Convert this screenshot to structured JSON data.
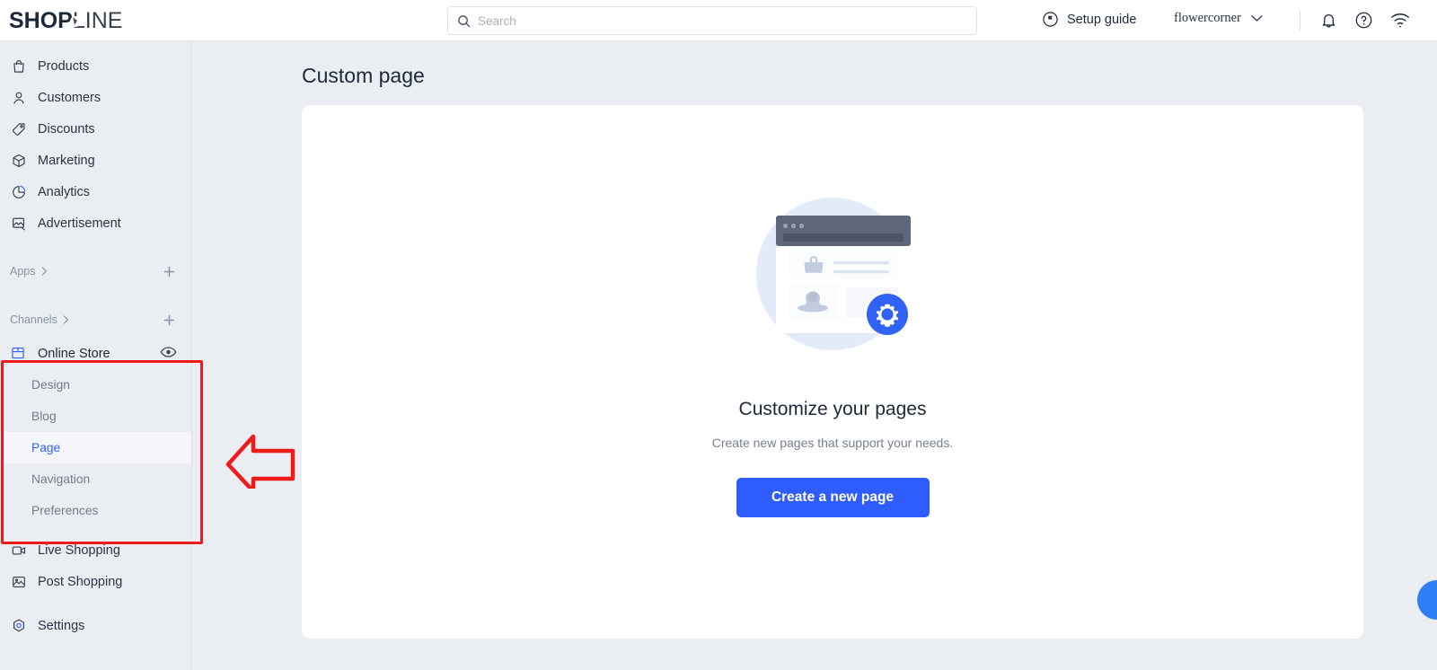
{
  "app": {
    "brand_bold": "SHOP",
    "brand_light": "LINE",
    "accent_blue": "#2f5cfd",
    "annotation_red": "#ee1b1b"
  },
  "topbar": {
    "search": {
      "placeholder": "Search",
      "value": ""
    },
    "setup_guide": "Setup guide",
    "store_name": "flowercorner",
    "icons": {
      "search": "search-icon",
      "setup": "flag-circle-icon",
      "chevron": "chevron-down-icon",
      "bell": "bell-icon",
      "help": "help-circle-icon",
      "wifi": "wifi-icon"
    }
  },
  "sidebar": {
    "primary": [
      {
        "label": "Products",
        "icon": "bag-icon"
      },
      {
        "label": "Customers",
        "icon": "person-icon"
      },
      {
        "label": "Discounts",
        "icon": "tag-icon"
      },
      {
        "label": "Marketing",
        "icon": "cube-icon"
      },
      {
        "label": "Analytics",
        "icon": "pie-chart-icon"
      },
      {
        "label": "Advertisement",
        "icon": "advertisement-icon"
      }
    ],
    "apps_section": {
      "label": "Apps",
      "add_label": "+"
    },
    "channels_section": {
      "label": "Channels",
      "add_label": "+"
    },
    "online_store": {
      "label": "Online Store",
      "icon": "store-icon",
      "preview_icon": "eye-icon"
    },
    "online_store_children": [
      {
        "label": "Design",
        "active": false
      },
      {
        "label": "Blog",
        "active": false
      },
      {
        "label": "Page",
        "active": true
      },
      {
        "label": "Navigation",
        "active": false
      },
      {
        "label": "Preferences",
        "active": false
      }
    ],
    "secondary": [
      {
        "label": "Live Shopping",
        "icon": "video-camera-icon"
      },
      {
        "label": "Post Shopping",
        "icon": "image-icon"
      }
    ],
    "settings": {
      "label": "Settings",
      "icon": "settings-gear-icon"
    }
  },
  "main": {
    "page_title": "Custom page",
    "empty_state": {
      "title": "Customize your pages",
      "subtitle": "Create new pages that support your needs.",
      "cta_label": "Create a new page",
      "illustration": "browser-window-with-gear-illustration"
    }
  },
  "annotations": {
    "highlight_box": "red-rectangle-around-online-store-menu",
    "arrow": "red-left-arrow-pointing-to-page-menu"
  }
}
